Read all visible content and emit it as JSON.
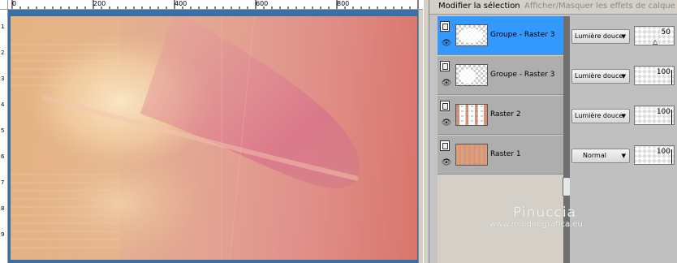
{
  "tabs": {
    "modify_selection": "Modifier la sélection",
    "toggle_effects": "Afficher/Masquer les effets de calque"
  },
  "ruler": {
    "h_labels": [
      "0",
      "200",
      "400",
      "600",
      "800"
    ],
    "v_labels": [
      "1",
      "2",
      "3",
      "4",
      "5",
      "6",
      "7",
      "8",
      "9"
    ]
  },
  "layers": [
    {
      "name": "Groupe - Raster 3",
      "blend": "Lumière douce",
      "opacity": "50",
      "selected": true,
      "thumb": "white-blob"
    },
    {
      "name": "Groupe - Raster 3",
      "blend": "Lumière douce",
      "opacity": "100",
      "selected": false,
      "thumb": "white-blob"
    },
    {
      "name": "Raster 2",
      "blend": "Lumière douce",
      "opacity": "100",
      "selected": false,
      "thumb": "stripes"
    },
    {
      "name": "Raster 1",
      "blend": "Normal",
      "opacity": "100",
      "selected": false,
      "thumb": "gradient"
    }
  ],
  "icons": {
    "layer_type": "document-icon",
    "visibility": "eye-icon",
    "dropdown": "chevron-down-icon"
  },
  "watermark": {
    "title": "Pinuccia",
    "url": "www.maidiregrafica.eu"
  },
  "colors": {
    "selection": "#3399ff",
    "panel_bg": "#c4c4c4",
    "row_bg": "#aeaeae"
  }
}
